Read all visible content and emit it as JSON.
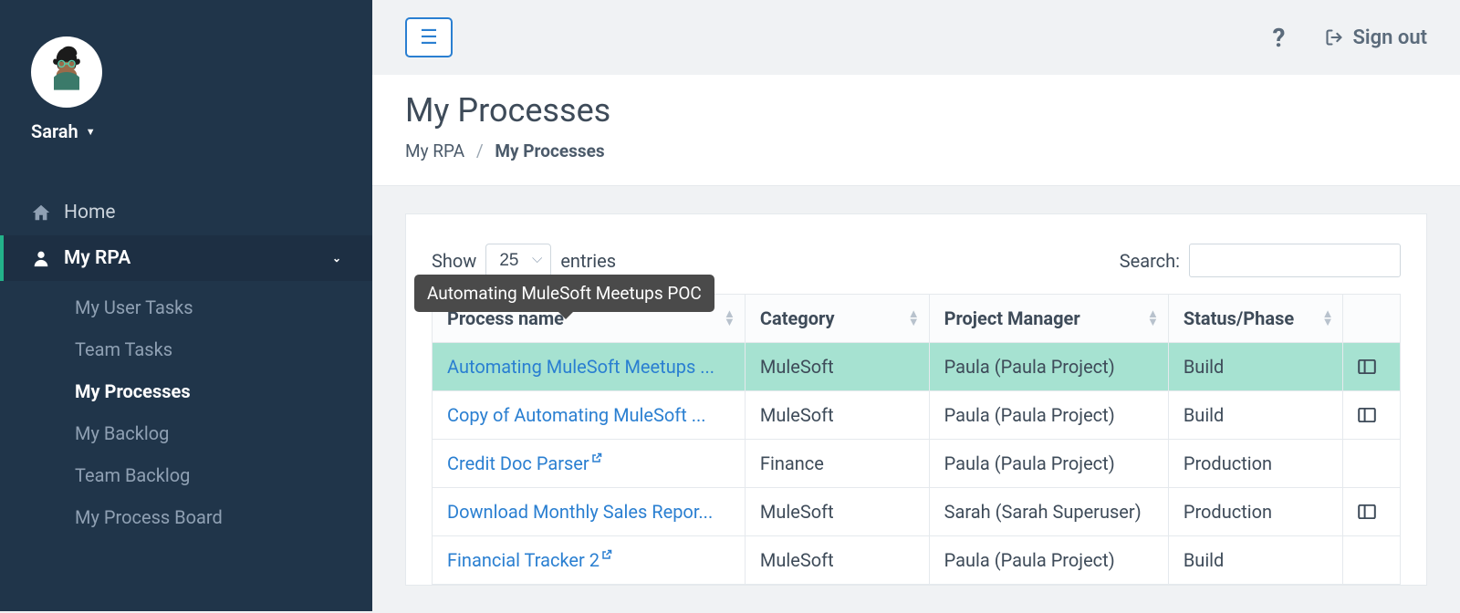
{
  "user": {
    "name": "Sarah"
  },
  "nav": {
    "home": "Home",
    "myrpa": "My RPA",
    "subs": {
      "userTasks": "My User Tasks",
      "teamTasks": "Team Tasks",
      "myProcesses": "My Processes",
      "myBacklog": "My Backlog",
      "teamBacklog": "Team Backlog",
      "processBoard": "My Process Board"
    }
  },
  "topbar": {
    "help": "?",
    "signout": "Sign out"
  },
  "header": {
    "title": "My Processes",
    "crumbRoot": "My RPA",
    "crumbCurrent": "My Processes"
  },
  "table": {
    "showLabel": "Show",
    "entriesLabel": "entries",
    "entriesValue": "25",
    "searchLabel": "Search:",
    "searchValue": "",
    "columns": {
      "process": "Process name",
      "category": "Category",
      "pm": "Project Manager",
      "status": "Status/Phase"
    },
    "rows": [
      {
        "name": "Automating MuleSoft Meetups ...",
        "category": "MuleSoft",
        "pm": "Paula (Paula Project)",
        "status": "Build",
        "external": false,
        "action": true,
        "highlight": true
      },
      {
        "name": "Copy of Automating MuleSoft ...",
        "category": "MuleSoft",
        "pm": "Paula (Paula Project)",
        "status": "Build",
        "external": false,
        "action": true,
        "highlight": false
      },
      {
        "name": "Credit Doc Parser",
        "category": "Finance",
        "pm": "Paula (Paula Project)",
        "status": "Production",
        "external": true,
        "action": false,
        "highlight": false
      },
      {
        "name": "Download Monthly Sales Repor...",
        "category": "MuleSoft",
        "pm": "Sarah (Sarah Superuser)",
        "status": "Production",
        "external": false,
        "action": true,
        "highlight": false
      },
      {
        "name": "Financial Tracker 2",
        "category": "MuleSoft",
        "pm": "Paula (Paula Project)",
        "status": "Build",
        "external": true,
        "action": false,
        "highlight": false
      }
    ]
  },
  "tooltip": {
    "text": "Automating MuleSoft Meetups POC"
  }
}
